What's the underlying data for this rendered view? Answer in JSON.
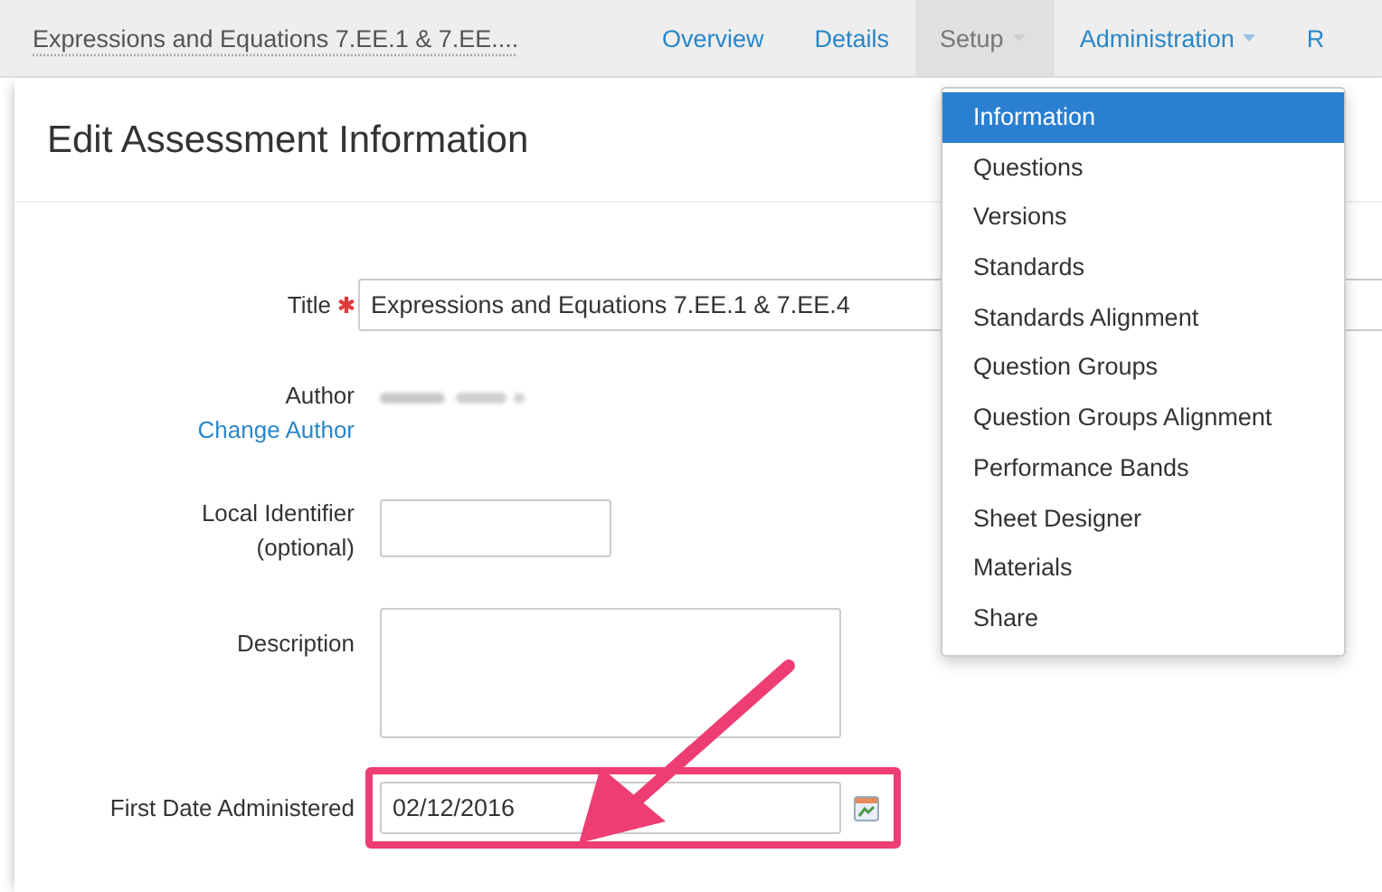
{
  "breadcrumb": "Expressions and Equations 7.EE.1 & 7.EE....",
  "nav": [
    {
      "label": "Overview",
      "selected": false,
      "dropdown": false
    },
    {
      "label": "Details",
      "selected": false,
      "dropdown": false
    },
    {
      "label": "Setup",
      "selected": true,
      "dropdown": true
    },
    {
      "label": "Administration",
      "selected": false,
      "dropdown": true
    },
    {
      "label": "R",
      "selected": false,
      "dropdown": false
    }
  ],
  "heading": "Edit Assessment Information",
  "form": {
    "title_label": "Title",
    "title_required": true,
    "title_value": "Expressions and Equations 7.EE.1 & 7.EE.4",
    "author_label": "Author",
    "author_link": "Change Author",
    "local_label": "Local Identifier",
    "local_hint": "(optional)",
    "description_label": "Description",
    "date_label": "First Date Administered",
    "date_value": "02/12/2016"
  },
  "menu": [
    {
      "label": "Information",
      "selected": true
    },
    {
      "label": "Questions",
      "selected": false
    },
    {
      "label": "Versions",
      "selected": false
    },
    {
      "label": "Standards",
      "selected": false
    },
    {
      "label": "Standards Alignment",
      "selected": false
    },
    {
      "label": "Question Groups",
      "selected": false
    },
    {
      "label": "Question Groups Alignment",
      "selected": false
    },
    {
      "label": "Performance Bands",
      "selected": false
    },
    {
      "label": "Sheet Designer",
      "selected": false
    },
    {
      "label": "Materials",
      "selected": false
    },
    {
      "label": "Share",
      "selected": false
    }
  ]
}
